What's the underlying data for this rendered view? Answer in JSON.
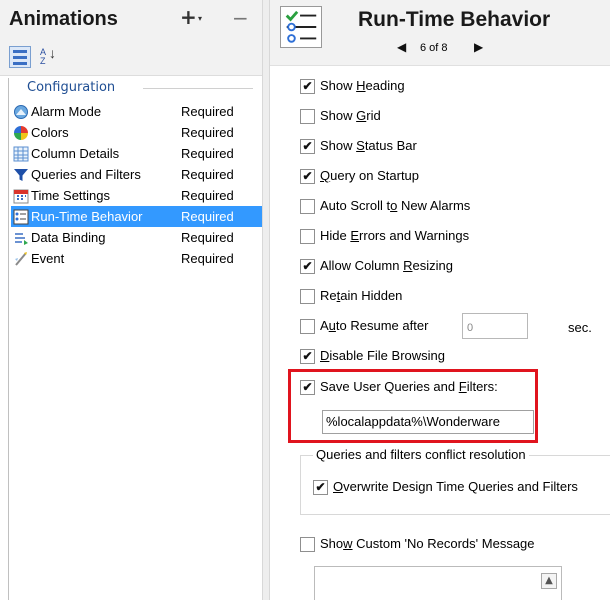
{
  "left_panel": {
    "title": "Animations",
    "add_symbol": "+",
    "dropdown_symbol": "▾",
    "remove_symbol": "−",
    "sort_az_symbol": "A\nZ",
    "group": "Configuration",
    "items": [
      {
        "label": "Alarm Mode",
        "status": "Required",
        "icon": "alarm-mode-icon"
      },
      {
        "label": "Colors",
        "status": "Required",
        "icon": "colors-icon"
      },
      {
        "label": "Column Details",
        "status": "Required",
        "icon": "column-details-icon"
      },
      {
        "label": "Queries and Filters",
        "status": "Required",
        "icon": "filter-icon"
      },
      {
        "label": "Time Settings",
        "status": "Required",
        "icon": "time-settings-icon"
      },
      {
        "label": "Run-Time Behavior",
        "status": "Required",
        "icon": "run-time-behavior-icon",
        "selected": true
      },
      {
        "label": "Data Binding",
        "status": "Required",
        "icon": "data-binding-icon"
      },
      {
        "label": "Event",
        "status": "Required",
        "icon": "event-icon"
      }
    ]
  },
  "right_panel": {
    "title": "Run-Time Behavior",
    "page_counter": "6 of 8",
    "prev_symbol": "◀",
    "next_symbol": "▶",
    "options": [
      {
        "pre": "Show ",
        "key": "H",
        "post": "eading",
        "checked": true
      },
      {
        "pre": "Show ",
        "key": "G",
        "post": "rid",
        "checked": false
      },
      {
        "pre": "Show ",
        "key": "S",
        "post": "tatus Bar",
        "checked": true
      },
      {
        "pre": "",
        "key": "Q",
        "post": "uery on Startup",
        "checked": true
      },
      {
        "pre": "Auto Scroll t",
        "key": "o",
        "post": " New Alarms",
        "checked": false
      },
      {
        "pre": "Hide ",
        "key": "E",
        "post": "rrors and Warnings",
        "checked": false
      },
      {
        "pre": "Allow Column ",
        "key": "R",
        "post": "esizing",
        "checked": true
      },
      {
        "pre": "Re",
        "key": "t",
        "post": "ain Hidden",
        "checked": false
      },
      {
        "pre": "A",
        "key": "u",
        "post": "to Resume after",
        "checked": false
      },
      {
        "pre": "",
        "key": "D",
        "post": "isable File Browsing",
        "checked": true
      },
      {
        "pre": "Save User Queries and ",
        "key": "F",
        "post": "ilters:",
        "checked": true
      }
    ],
    "auto_resume_value": "0",
    "auto_resume_unit": "sec.",
    "save_path": "%localappdata%\\Wonderware",
    "conflict_group_title": "Queries and filters conflict resolution",
    "overwrite": {
      "pre": "",
      "key": "O",
      "post": "verwrite Design Time Queries and Filters",
      "checked": true
    },
    "custom_message": {
      "pre": "Sho",
      "key": "w",
      "post": " Custom 'No Records' Message",
      "checked": false
    },
    "check_mark": "✔"
  },
  "colors": {
    "selection": "#3399ff",
    "highlight_border": "#e0141e",
    "group_label": "#1f4e93"
  }
}
